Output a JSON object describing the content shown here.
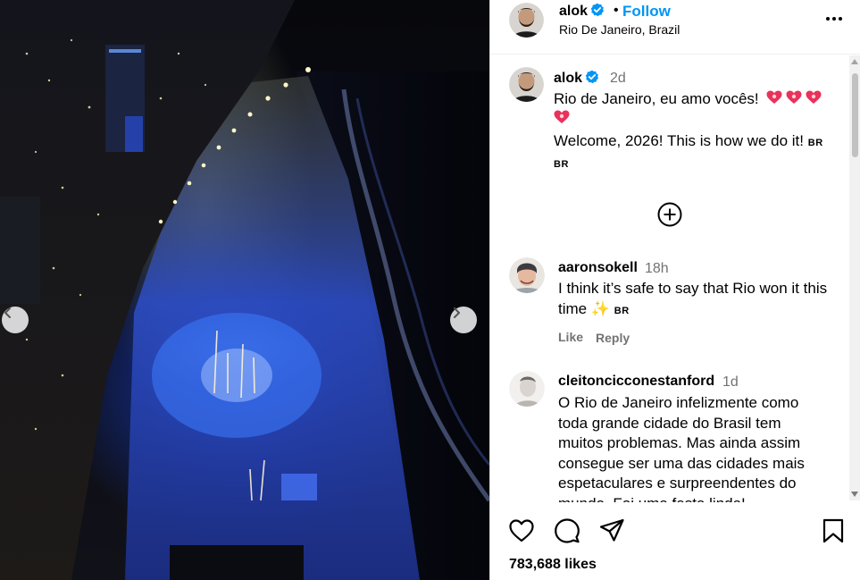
{
  "post": {
    "author": "alok",
    "location": "Rio De Janeiro, Brazil",
    "follow_separator": "•",
    "follow_label": "Follow",
    "likes": "783,688 likes"
  },
  "caption": {
    "author": "alok",
    "time": "2d",
    "line1": "Rio de Janeiro, eu amo vocês!",
    "line2": "Welcome, 2026! This is how we do it!",
    "flag1": "BR",
    "flag2": "BR"
  },
  "comments": [
    {
      "user": "aaronsokell",
      "time": "18h",
      "text": "I think it’s safe to say that Rio won it this time",
      "sparkle": "✨",
      "flag": "BR",
      "like_label": "Like",
      "reply_label": "Reply"
    },
    {
      "user": "cleitoncicconestanford",
      "time": "1d",
      "text": "O Rio de Janeiro infelizmente como toda grande cidade do Brasil tem muitos problemas. Mas ainda assim consegue ser uma das cidades mais espetaculares e surpreendentes do mundo. Foi uma festa linda!"
    }
  ],
  "icons": {
    "verified": "verified-badge-icon",
    "more": "more-options-icon",
    "prev": "chevron-left-icon",
    "next": "chevron-right-icon",
    "add": "plus-circle-icon",
    "like": "heart-icon",
    "comment": "comment-bubble-icon",
    "share": "paper-plane-icon",
    "save": "bookmark-icon"
  },
  "colors": {
    "accent": "#0095f6",
    "muted": "#737373",
    "heart_emoji": "#e8325a"
  }
}
